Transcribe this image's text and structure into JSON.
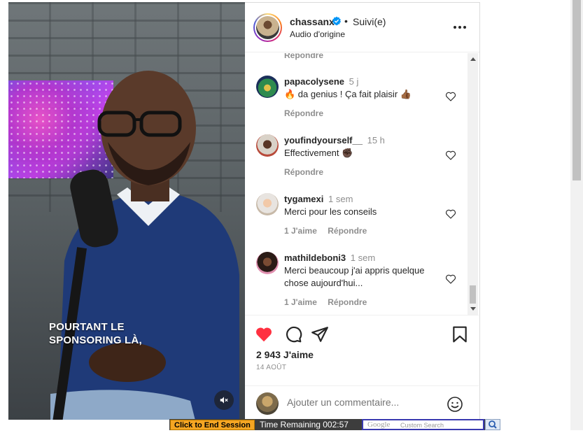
{
  "video": {
    "caption_line1": "POURTANT LE",
    "caption_line2": "SPONSORING LÀ,",
    "mute_icon": "speaker-muted-icon"
  },
  "header": {
    "username": "chassanx",
    "separator": "•",
    "follow_status": "Suivi(e)",
    "audio": "Audio d'origine",
    "verified_color": "#0095f6"
  },
  "comments": {
    "partial_reply_label": "Répondre",
    "items": [
      {
        "username": "papacolysene",
        "time": "5 j",
        "text": "🔥 da genius ! Ça fait plaisir 👍🏾",
        "likes_label": "",
        "reply_label": "Répondre"
      },
      {
        "username": "youfindyourself__",
        "time": "15 h",
        "text": "Effectivement ✊🏿",
        "likes_label": "",
        "reply_label": "Répondre"
      },
      {
        "username": "tygamexi",
        "time": "1 sem",
        "text": "Merci pour les conseils",
        "likes_label": "1 J'aime",
        "reply_label": "Répondre"
      },
      {
        "username": "mathildeboni3",
        "time": "1 sem",
        "text": "Merci beaucoup j'ai appris quelque chose aujourd'hui...",
        "likes_label": "1 J'aime",
        "reply_label": "Répondre"
      }
    ]
  },
  "actions": {
    "like_color": "#ff3040",
    "likes": "2 943 J'aime",
    "date": "14 AOÛT"
  },
  "add_comment": {
    "placeholder": "Ajouter un commentaire..."
  },
  "session_bar": {
    "end_label": "Click to End Session",
    "time_remaining": "Time Remaining 002:57",
    "google_label": "Google",
    "custom_search": "Custom Search"
  }
}
